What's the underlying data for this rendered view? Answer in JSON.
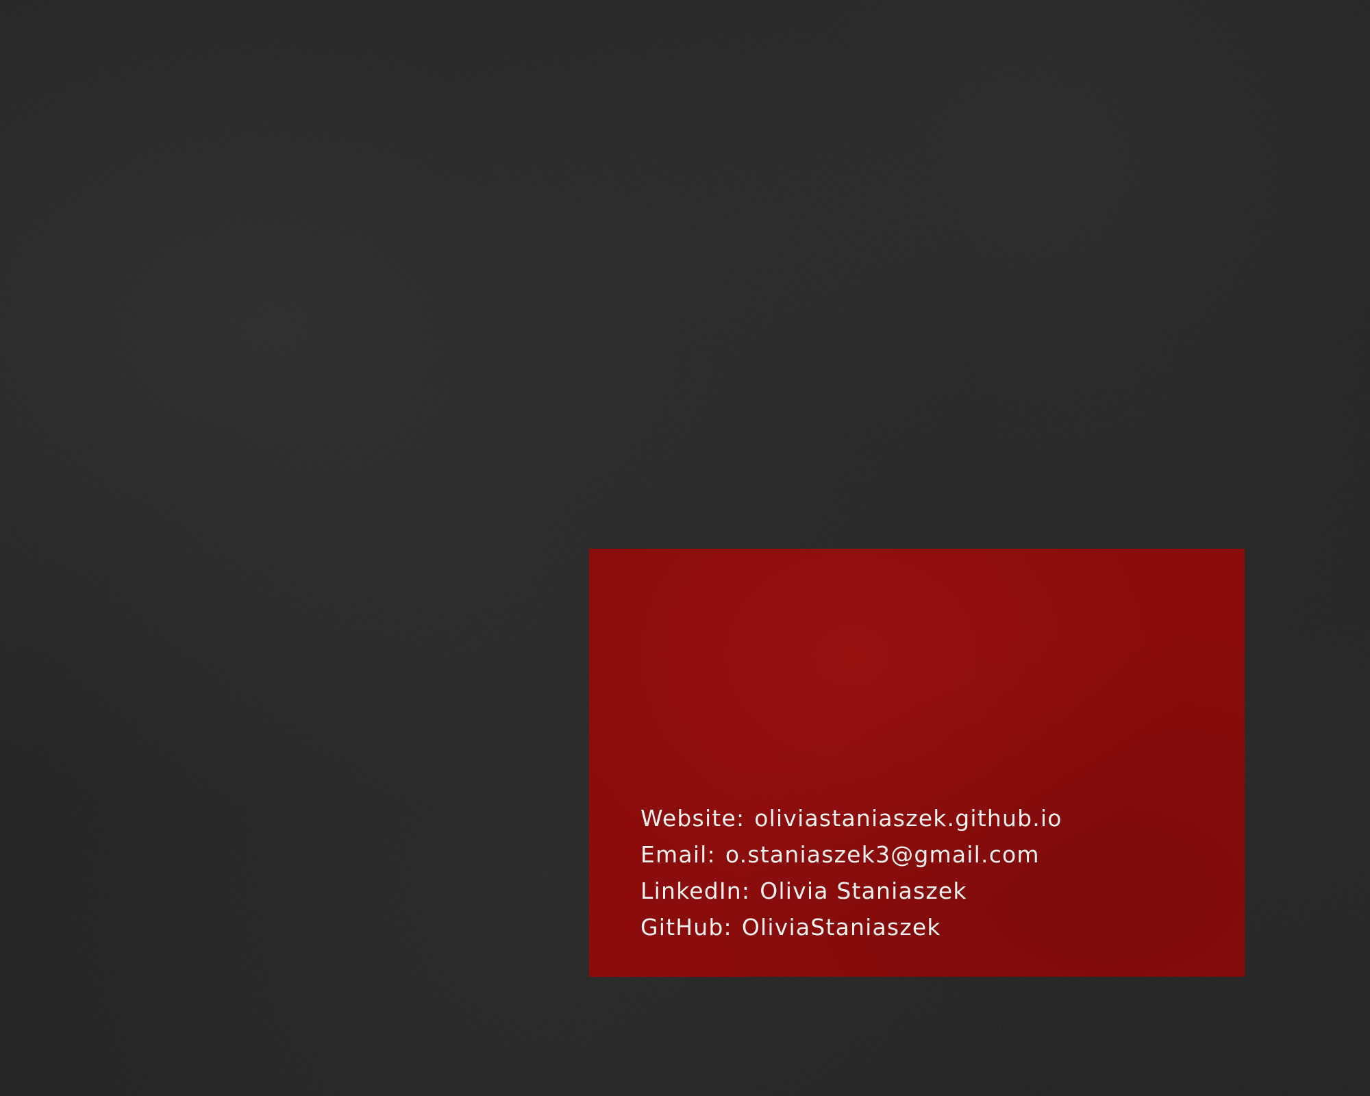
{
  "background": {
    "color": "#1c1c1c",
    "texture": "dark distressed grain"
  },
  "card": {
    "color": "#8a0c0c",
    "text_color": "#f5f1ee",
    "contacts": [
      {
        "label": "Website:",
        "value": "oliviastaniaszek.github.io"
      },
      {
        "label": "Email:",
        "value": "o.staniaszek3@gmail.com"
      },
      {
        "label": "LinkedIn:",
        "value": "Olivia Staniaszek"
      },
      {
        "label": "GitHub:",
        "value": "OliviaStaniaszek"
      }
    ]
  }
}
